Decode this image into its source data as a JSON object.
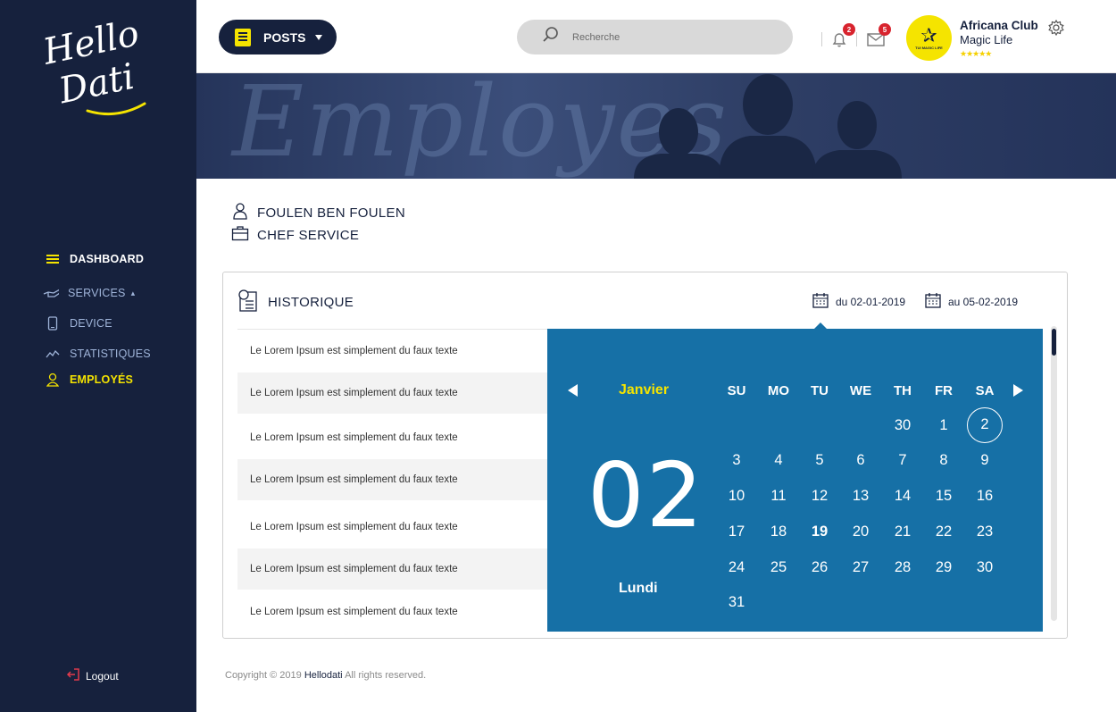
{
  "sidebar": {
    "logo_text": [
      "Hello",
      "Dati"
    ],
    "nav": [
      {
        "label": "DASHBOARD",
        "icon": "bars-icon"
      },
      {
        "label": "SERVICES",
        "icon": "hand-icon"
      },
      {
        "label": "DEVICE",
        "icon": "phone-icon"
      },
      {
        "label": "STATISTIQUES",
        "icon": "chart-line-icon"
      },
      {
        "label": "EMPLOYÉS",
        "icon": "user-icon"
      }
    ],
    "services_caret": "▴",
    "logout": "Logout"
  },
  "header": {
    "posts_label": "POSTS",
    "search_placeholder": "Recherche",
    "notifications_count": "2",
    "messages_count": "5",
    "club_name": "Africana Club",
    "club_sub": "Magic Life",
    "club_logo_text": "TUI MAGIC LIFE",
    "rating_stars": "★★★★★"
  },
  "banner": {
    "word": "Employes"
  },
  "employee": {
    "name": "FOULEN BEN FOULEN",
    "role": "CHEF SERVICE"
  },
  "historique": {
    "title": "HISTORIQUE",
    "date_from": "du 02-01-2019",
    "date_to": "au 05-02-2019",
    "rows": [
      "Le Lorem Ipsum est simplement du faux texte",
      "Le Lorem Ipsum est simplement du faux texte",
      "Le Lorem Ipsum est simplement du faux texte",
      "Le Lorem Ipsum est simplement du faux texte",
      "Le Lorem Ipsum est simplement du faux texte",
      "Le Lorem Ipsum est simplement du faux texte",
      "Le Lorem Ipsum est simplement du faux texte"
    ]
  },
  "calendar": {
    "month": "Janvier",
    "big_day": "02",
    "day_name": "Lundi",
    "weekdays": [
      "SU",
      "MO",
      "TU",
      "WE",
      "TH",
      "FR",
      "SA"
    ],
    "weeks": [
      [
        "",
        "",
        "",
        "",
        "30",
        "1",
        "2"
      ],
      [
        "3",
        "4",
        "5",
        "6",
        "7",
        "8",
        "9"
      ],
      [
        "10",
        "11",
        "12",
        "13",
        "14",
        "15",
        "16"
      ],
      [
        "17",
        "18",
        "19",
        "20",
        "21",
        "22",
        "23"
      ],
      [
        "24",
        "25",
        "26",
        "27",
        "28",
        "29",
        "30"
      ],
      [
        "31",
        "",
        "",
        "",
        "",
        "",
        ""
      ]
    ],
    "selected_day": "2",
    "bold_day": "19",
    "accent_color": "#1670a6",
    "month_color": "#f5e400"
  },
  "footer": {
    "prefix": "Copyright © 2019",
    "brand": "Hellodati",
    "suffix": "All rights reserved."
  }
}
